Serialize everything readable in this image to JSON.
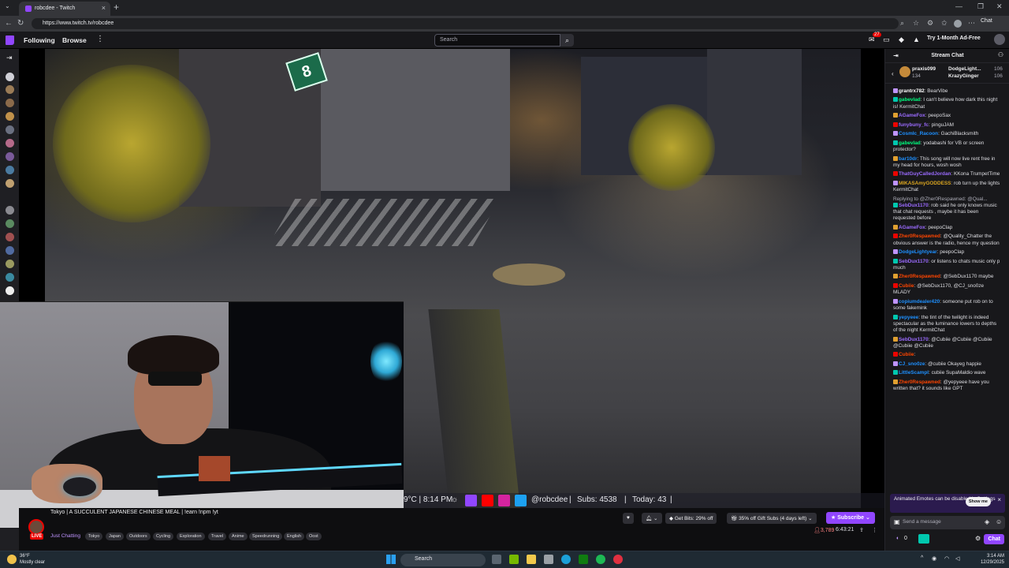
{
  "browser": {
    "tab_title": "robcdee - Twitch",
    "url": "https://www.twitch.tv/robcdee",
    "chat_label": "Chat"
  },
  "twitch_nav": {
    "following": "Following",
    "browse": "Browse",
    "search_placeholder": "Search",
    "notifications_count": "27",
    "ad_free": "Try 1-Month Ad-Free"
  },
  "stream_overlay": {
    "weather_time": "9°C | 8:14 PM",
    "handle": "@robcdee",
    "subs": "Subs: 4538",
    "today": "Today: 43",
    "sign_number": "8"
  },
  "channel": {
    "title": "Tokyo | A SUCCULENT JAPANESE CHINESE MEAL | !earn !npm !yt",
    "category": "Just Chatting",
    "live_label": "LIVE",
    "tags": [
      "Tokyo",
      "Japan",
      "Outdoors",
      "Cycling",
      "Exploration",
      "Travel",
      "Anime",
      "Speedrunning",
      "English",
      "Oost"
    ],
    "get_bits": "Get Bits: 29% off",
    "gift_subs": "35% off Gift Subs (4 days left)",
    "subscribe": "Subscribe",
    "viewers": "3,789",
    "uptime": "6:43:21"
  },
  "chat": {
    "header": "Stream Chat",
    "leaderboard": [
      {
        "name": "praxis099",
        "value": "134"
      },
      {
        "name": "DodgeLight...",
        "value": "106"
      },
      {
        "name": "KrazyGinger",
        "value": "106"
      }
    ],
    "messages": [
      {
        "user": "grantrx782",
        "color": "#ffffff",
        "text": "BearVibe"
      },
      {
        "user": "gabevlad",
        "color": "#00ff7f",
        "text": "I can't believe how dark this night is! KermitChat"
      },
      {
        "user": "AGameFox",
        "color": "#9b6bff",
        "text": "peepoSax"
      },
      {
        "user": "funybuny_fc",
        "color": "#9b6bff",
        "text": "pinguJAM"
      },
      {
        "user": "CosmIc_Racoon",
        "color": "#1e90ff",
        "text": "GachiBlacksmith"
      },
      {
        "user": "gabevlad",
        "color": "#00ff7f",
        "text": "yodabashi for VB or screen protector?"
      },
      {
        "user": "bar10dr",
        "color": "#1e90ff",
        "text": "This song will now live rent free in my head for hours, wosh wosh"
      },
      {
        "user": "ThatGuyCalledJordan",
        "color": "#9b6bff",
        "text": "KKona TrumpetTime"
      },
      {
        "user": "MIKASAmyGODDESS",
        "color": "#daa520",
        "text": "rob turn up the lights KermitChat"
      },
      {
        "user": "SebDux1170",
        "color": "#9b6bff",
        "text": "rob said he only knows music that chat requests , maybe it has been requested before",
        "reply": "Replying to @Zher0Respawned: @Qual..."
      },
      {
        "user": "AGameFox",
        "color": "#9b6bff",
        "text": "peepoClap"
      },
      {
        "user": "Zher0Respawned",
        "color": "#ff4500",
        "text": "@Quality_Chatter the obvious answer is the radio, hence my question"
      },
      {
        "user": "DodgeLightyear",
        "color": "#1e90ff",
        "text": "peepoClap"
      },
      {
        "user": "SebDux1170",
        "color": "#9b6bff",
        "text": "or listens to chats music only p much"
      },
      {
        "user": "Zher0Respawned",
        "color": "#ff4500",
        "text": "@SebDux1170 maybe"
      },
      {
        "user": "Cubiie",
        "color": "#ff4500",
        "text": "@SebDux1170, @CJ_sno0ze MLADY"
      },
      {
        "user": "copiumdealer420",
        "color": "#1e90ff",
        "text": "someone put rob on to some fakemink"
      },
      {
        "user": "yepyeee",
        "color": "#1e90ff",
        "text": "the tint of the twilight is indeed spectacular as the luminance lowers to depths of the night KermitChat"
      },
      {
        "user": "SebDux1170",
        "color": "#9b6bff",
        "text": "@Cubiie @Cubiie @Cubiie @Cubiie @Cubiie"
      },
      {
        "user": "Cubiie",
        "color": "#ff4500",
        "text": ""
      },
      {
        "user": "CJ_sno0ze",
        "color": "#1e90ff",
        "text": "@cubiie Okayeg happie"
      },
      {
        "user": "LittleScampl",
        "color": "#1e90ff",
        "text": "cubiie SupaMaldio wave"
      },
      {
        "user": "Zher0Respawned",
        "color": "#ff4500",
        "text": "@yepyeee have you written that? it sounds like GPT"
      }
    ],
    "notice": "Animated Emotes can be disabled in Settings",
    "notice_button": "Show me",
    "input_placeholder": "Send a message",
    "points": "0",
    "chat_button": "Chat"
  },
  "taskbar": {
    "temp": "36°F",
    "weather": "Mostly clear",
    "search": "Search",
    "time": "3:14 AM",
    "date": "12/29/2025"
  }
}
